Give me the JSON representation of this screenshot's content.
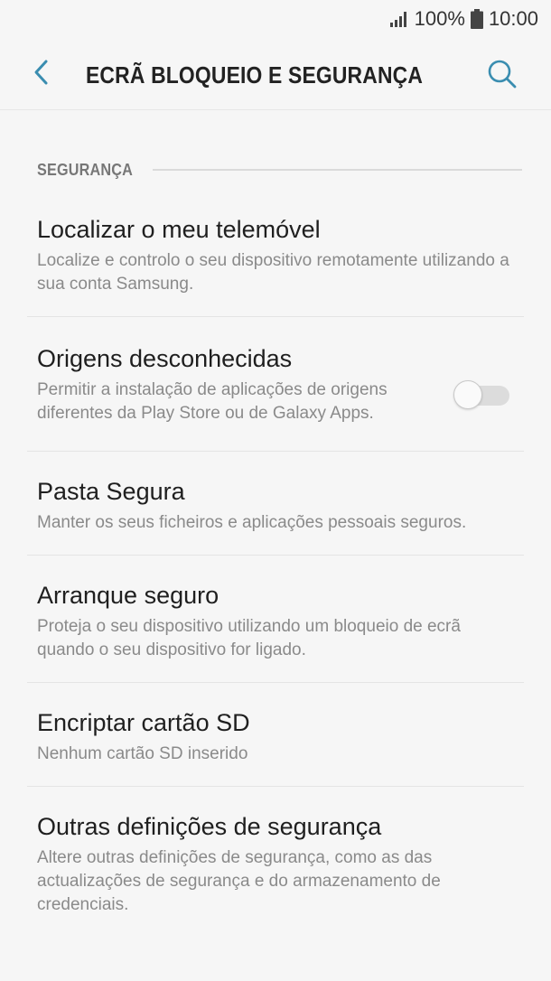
{
  "status_bar": {
    "signal_icon": "signal-bars-icon",
    "battery_percent": "100%",
    "battery_icon": "battery-icon",
    "time": "10:00"
  },
  "header": {
    "back_icon": "chevron-left-icon",
    "title": "ECRÃ BLOQUEIO E SEGURANÇA",
    "search_icon": "search-icon"
  },
  "colors": {
    "accent": "#3a8db0",
    "background": "#f6f6f6",
    "title_text": "#1f1f1f",
    "subtitle_text": "#8a8a8a"
  },
  "section": {
    "title": "SEGURANÇA"
  },
  "items": [
    {
      "title": "Localizar o meu telemóvel",
      "subtitle": "Localize e controlo o seu dispositivo remotamente utilizando a sua conta Samsung."
    },
    {
      "title": "Origens desconhecidas",
      "subtitle": "Permitir a instalação de aplicações de origens diferentes da Play Store ou de Galaxy Apps.",
      "toggle": "off"
    },
    {
      "title": "Pasta Segura",
      "subtitle": "Manter os seus ficheiros e aplicações pessoais seguros."
    },
    {
      "title": "Arranque seguro",
      "subtitle": "Proteja o seu dispositivo utilizando um bloqueio de ecrã quando o seu dispositivo for ligado."
    },
    {
      "title": "Encriptar cartão SD",
      "subtitle": "Nenhum cartão SD inserido"
    },
    {
      "title": "Outras definições de segurança",
      "subtitle": "Altere outras definições de segurança, como as das actualizações de segurança e do armazenamento de credenciais."
    }
  ]
}
